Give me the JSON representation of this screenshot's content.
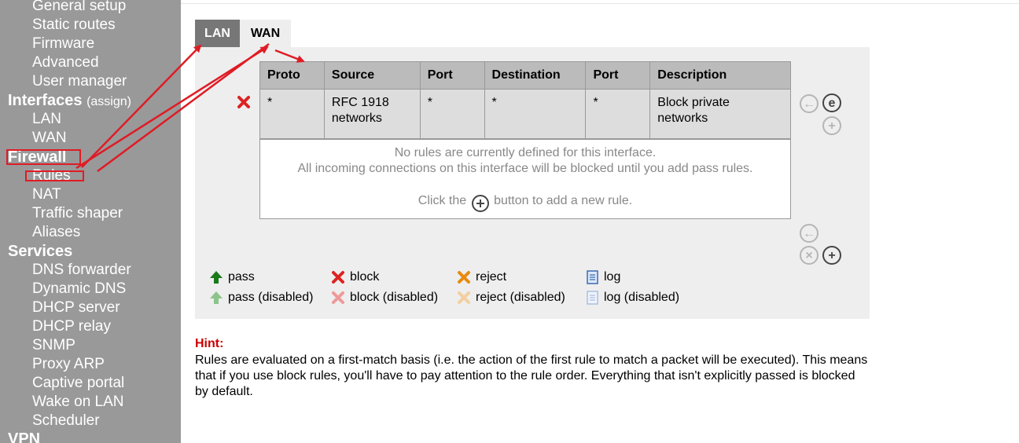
{
  "sidebar": {
    "items": [
      {
        "label": "General setup"
      },
      {
        "label": "Static routes"
      },
      {
        "label": "Firmware"
      },
      {
        "label": "Advanced"
      },
      {
        "label": "User manager"
      }
    ],
    "interfaces": {
      "heading": "Interfaces",
      "assign": "(assign)",
      "items": [
        "LAN",
        "WAN"
      ]
    },
    "firewall": {
      "heading": "Firewall",
      "items": [
        "Rules",
        "NAT",
        "Traffic shaper",
        "Aliases"
      ]
    },
    "services": {
      "heading": "Services",
      "items": [
        "DNS forwarder",
        "Dynamic DNS",
        "DHCP server",
        "DHCP relay",
        "SNMP",
        "Proxy ARP",
        "Captive portal",
        "Wake on LAN",
        "Scheduler"
      ]
    },
    "vpn": {
      "heading": "VPN"
    }
  },
  "tabs": [
    {
      "label": "LAN",
      "active": true
    },
    {
      "label": "WAN",
      "active": false
    }
  ],
  "table": {
    "headers": [
      "Proto",
      "Source",
      "Port",
      "Destination",
      "Port",
      "Description"
    ],
    "rows": [
      {
        "proto": "*",
        "source": "RFC 1918 networks",
        "port": "*",
        "destination": "*",
        "dport": "*",
        "description": "Block private networks",
        "action_icon": "block-icon"
      }
    ]
  },
  "empty": {
    "line1": "No rules are currently defined for this interface.",
    "line2": "All incoming connections on this interface will be blocked until you add pass rules.",
    "click_before": "Click the",
    "click_after": "button to add a new rule."
  },
  "legend": {
    "pass": "pass",
    "pass_disabled": "pass (disabled)",
    "block": "block",
    "block_disabled": "block (disabled)",
    "reject": "reject",
    "reject_disabled": "reject (disabled)",
    "log": "log",
    "log_disabled": "log (disabled)"
  },
  "hint": {
    "title": "Hint:",
    "text": "Rules are evaluated on a first-match basis (i.e. the action of the first rule to match a packet will be executed). This means that if you use block rules, you'll have to pay attention to the rule order. Everything that isn't explicitly passed is blocked by default."
  },
  "colors": {
    "sidebar_bg": "#999999",
    "panel_bg": "#eeeeee",
    "annotation_red": "#e01b24",
    "hint_red": "#cc0000",
    "pass_green": "#1a7a1a",
    "block_red": "#dd2222",
    "reject_orange": "#e88a10"
  }
}
